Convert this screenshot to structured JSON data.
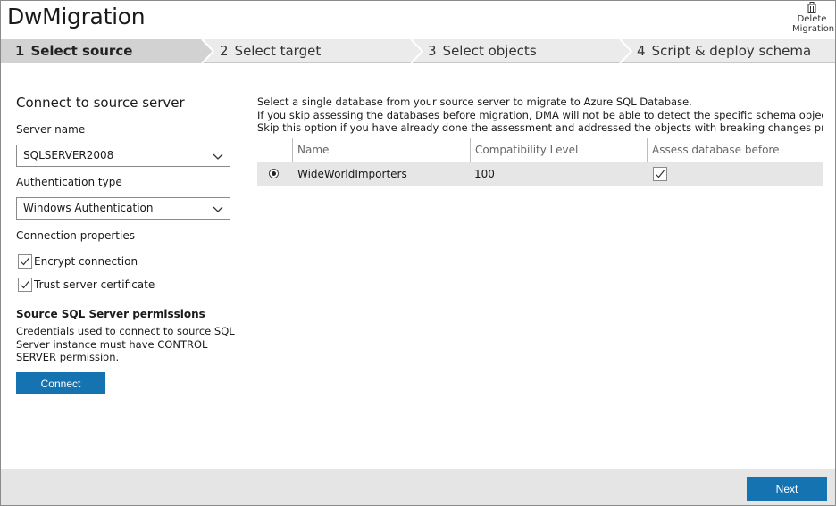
{
  "app": {
    "title": "DwMigration"
  },
  "toolbar": {
    "delete_migration_label": "Delete Migration",
    "delete_line1": "Delete",
    "delete_line2": "Migration"
  },
  "steps": [
    {
      "num": "1",
      "label": "Select source",
      "active": true
    },
    {
      "num": "2",
      "label": "Select target",
      "active": false
    },
    {
      "num": "3",
      "label": "Select objects",
      "active": false
    },
    {
      "num": "4",
      "label": "Script & deploy schema",
      "active": false
    }
  ],
  "source": {
    "heading": "Connect to source server",
    "server_name_label": "Server name",
    "server_name_value": "SQLSERVER2008",
    "auth_type_label": "Authentication type",
    "auth_type_value": "Windows Authentication",
    "conn_props_label": "Connection properties",
    "encrypt_label": "Encrypt connection",
    "encrypt_checked": true,
    "trust_label": "Trust server certificate",
    "trust_checked": true,
    "permissions_title": "Source SQL Server permissions",
    "permissions_text": "Credentials used to connect to source SQL Server instance must have CONTROL SERVER permission.",
    "connect_label": "Connect"
  },
  "info": {
    "line1": "Select a single database from your source server to migrate to Azure SQL Database.",
    "line2": "If you skip assessing the databases before migration, DMA will not be able to detect the specific schema objects that may fail to de",
    "line3": "Skip this option if you have already done the assessment and addressed the objects with breaking changes prior to the migration."
  },
  "grid": {
    "columns": [
      "Name",
      "Compatibility Level",
      "Assess database before migration?"
    ],
    "rows": [
      {
        "selected": true,
        "name": "WideWorldImporters",
        "compat": "100",
        "assess": true
      }
    ]
  },
  "footer": {
    "next_label": "Next"
  },
  "colors": {
    "accent": "#1673b1",
    "step_active": "#d2d2d2",
    "step_bar": "#ebebeb",
    "row_selected": "#e6e6e6",
    "footer": "#e5e5e5"
  },
  "icons": {
    "delete": "trash-icon",
    "dropdown": "chevron-down-icon",
    "check": "checkmark-icon"
  }
}
